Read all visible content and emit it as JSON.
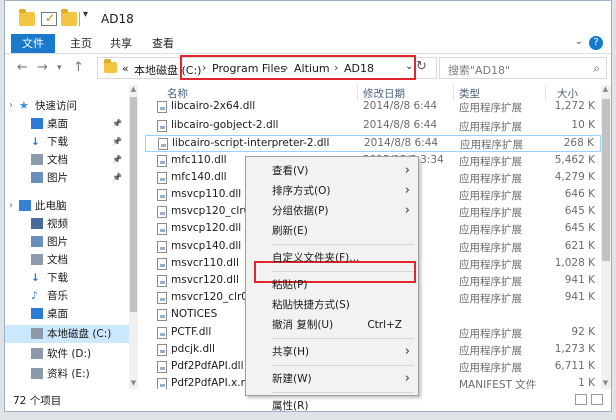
{
  "window": {
    "title": "AD18"
  },
  "ribbon": {
    "tabs": [
      "文件",
      "主页",
      "共享",
      "查看"
    ],
    "help": "?"
  },
  "address": {
    "prefix": "«",
    "segments": [
      "本地磁盘 (C:)",
      "Program Files",
      "Altium",
      "AD18"
    ]
  },
  "search": {
    "placeholder": "搜索\"AD18\""
  },
  "sidebar": {
    "items": [
      {
        "label": "快速访问",
        "icon": "star-icon"
      },
      {
        "label": "桌面",
        "icon": "desktop-icon",
        "pinned": true
      },
      {
        "label": "下载",
        "icon": "download-icon",
        "pinned": true
      },
      {
        "label": "文档",
        "icon": "document-icon",
        "pinned": true
      },
      {
        "label": "图片",
        "icon": "picture-icon",
        "pinned": true
      },
      {
        "label": "此电脑",
        "icon": "computer-icon"
      },
      {
        "label": "视频",
        "icon": "video-icon"
      },
      {
        "label": "图片",
        "icon": "picture-icon"
      },
      {
        "label": "文档",
        "icon": "document-icon"
      },
      {
        "label": "下载",
        "icon": "download-icon"
      },
      {
        "label": "音乐",
        "icon": "music-icon"
      },
      {
        "label": "桌面",
        "icon": "desktop-icon"
      },
      {
        "label": "本地磁盘 (C:)",
        "icon": "drive-icon",
        "selected": true
      },
      {
        "label": "软件 (D:)",
        "icon": "drive-icon"
      },
      {
        "label": "资料 (E:)",
        "icon": "drive-icon"
      }
    ]
  },
  "columns": {
    "name": "名称",
    "date": "修改日期",
    "type": "类型",
    "size": "大小"
  },
  "files": [
    {
      "name": "libcairo-2x64.dll",
      "date": "2014/8/8 6:44",
      "type": "应用程序扩展",
      "size": "1,272 K"
    },
    {
      "name": "libcairo-gobject-2.dll",
      "date": "2014/8/8 6:44",
      "type": "应用程序扩展",
      "size": "10 K"
    },
    {
      "name": "libcairo-script-interpreter-2.dll",
      "date": "2014/8/8 6:44",
      "type": "应用程序扩展",
      "size": "268 K"
    },
    {
      "name": "mfc110.dll",
      "date": "2015/12/3 3:34",
      "type": "应用程序扩展",
      "size": "5,462 K"
    },
    {
      "name": "mfc140.dll",
      "date": "3:34",
      "type": "应用程序扩展",
      "size": "4,279 K"
    },
    {
      "name": "msvcp110.dll",
      "date": "3:34",
      "type": "应用程序扩展",
      "size": "646 K"
    },
    {
      "name": "msvcp120_clr04",
      "date": "20:03",
      "type": "应用程序扩展",
      "size": "645 K"
    },
    {
      "name": "msvcp120.dll",
      "date": "20:03",
      "type": "应用程序扩展",
      "size": "645 K"
    },
    {
      "name": "msvcp140.dll",
      "date": "3:34",
      "type": "应用程序扩展",
      "size": "621 K"
    },
    {
      "name": "msvcr110.dll",
      "date": "3:34",
      "type": "应用程序扩展",
      "size": "1,028 K"
    },
    {
      "name": "msvcr120.dll",
      "date": "20:03",
      "type": "应用程序扩展",
      "size": "941 K"
    },
    {
      "name": "msvcr120_clr04",
      "date": "20:03",
      "type": "应用程序扩展",
      "size": "941 K"
    },
    {
      "name": "NOTICES",
      "date": "",
      "type": "",
      "size": ""
    },
    {
      "name": "PCTF.dll",
      "date": "3:34",
      "type": "应用程序扩展",
      "size": "92 K"
    },
    {
      "name": "pdcjk.dll",
      "date": "",
      "type": "应用程序扩展",
      "size": "1,273 K"
    },
    {
      "name": "Pdf2PdfAPI.dll",
      "date": "20:03",
      "type": "应用程序扩展",
      "size": "6,711 K"
    },
    {
      "name": "Pdf2PdfAPI.x.m",
      "date": "20:03",
      "type": "MANIFEST 文件",
      "size": "1 K"
    }
  ],
  "status": {
    "count": "72 个项目"
  },
  "context_menu": {
    "items": [
      {
        "label": "查看(V)",
        "submenu": true
      },
      {
        "label": "排序方式(O)",
        "submenu": true
      },
      {
        "label": "分组依据(P)",
        "submenu": true
      },
      {
        "label": "刷新(E)"
      },
      {
        "separator": true
      },
      {
        "label": "自定义文件夹(F)..."
      },
      {
        "separator": true
      },
      {
        "label": "粘贴(P)",
        "highlighted": true
      },
      {
        "label": "粘贴快捷方式(S)"
      },
      {
        "label": "撤消 复制(U)",
        "shortcut": "Ctrl+Z"
      },
      {
        "separator": true
      },
      {
        "label": "共享(H)",
        "submenu": true
      },
      {
        "separator": true
      },
      {
        "label": "新建(W)",
        "submenu": true
      },
      {
        "separator": true
      },
      {
        "label": "属性(R)"
      }
    ]
  },
  "colors": {
    "accent": "#1979ca",
    "highlight_box": "#e0252b",
    "selection": "#cce8ff"
  }
}
